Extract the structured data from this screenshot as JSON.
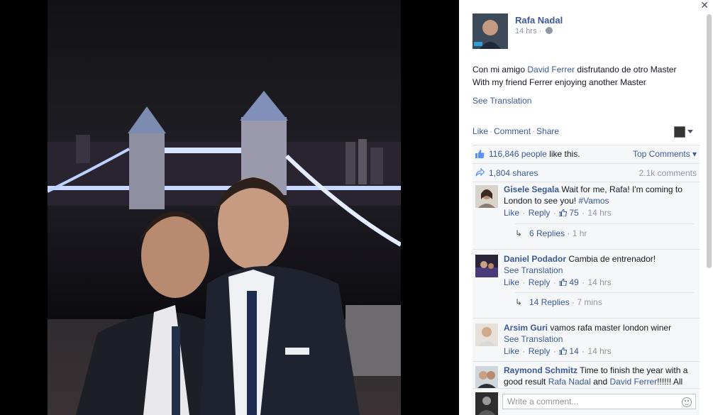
{
  "viewer": {
    "close_glyph": "✕"
  },
  "post": {
    "author": "Rafa Nadal",
    "time": "14 hrs",
    "meta_separator": "·",
    "text_line1_pre": "Con mi amigo ",
    "text_line1_link": "David Ferrer",
    "text_line1_post": " disfrutando de otro Master",
    "text_line2": "With my friend Ferrer enjoying another Master",
    "see_translation": "See Translation"
  },
  "actions": {
    "like": "Like",
    "comment": "Comment",
    "share": "Share",
    "separator": "·"
  },
  "ufi": {
    "likes_count": "116,846 people",
    "likes_suffix": " like this.",
    "top_comments": "Top Comments ▾",
    "shares": "1,804 shares",
    "comments_count": "2.1k comments"
  },
  "comments": [
    {
      "author": "Gisele Segala",
      "text": " Wait for me, Rafa! I'm coming to London to see you! ",
      "hashtag": "#Vamos",
      "like": "Like",
      "reply": "Reply",
      "likes": "75",
      "time": "14 hrs",
      "replies": "6 Replies",
      "replies_time": "1 hr"
    },
    {
      "author": "Daniel Podador",
      "text": " Cambia de entrenador!",
      "see_translation": "See Translation",
      "like": "Like",
      "reply": "Reply",
      "likes": "49",
      "time": "14 hrs",
      "replies": "14 Replies",
      "replies_time": "7 mins"
    },
    {
      "author": "Arsim Guri",
      "text": " vamos rafa master london winer",
      "see_translation": "See Translation",
      "like": "Like",
      "reply": "Reply",
      "likes": "14",
      "time": "14 hrs"
    },
    {
      "author": "Raymond Schmitz",
      "text_pre": " Time to finish the year with a good result ",
      "link1": "Rafa Nadal",
      "text_mid": " and ",
      "link2": "David Ferrer",
      "text_post": "!!!!!! All"
    }
  ],
  "composer": {
    "placeholder": "Write a comment..."
  },
  "icons": {
    "close": "close-icon",
    "globe": "globe-icon",
    "like": "thumbs-up-icon",
    "share": "share-arrow-icon",
    "reply": "reply-arrow-icon",
    "smiley": "smiley-icon",
    "caret": "chevron-down-icon"
  },
  "colors": {
    "link": "#3b5998",
    "muted": "#9197a3",
    "ufi_bg": "#f6f7f8"
  }
}
